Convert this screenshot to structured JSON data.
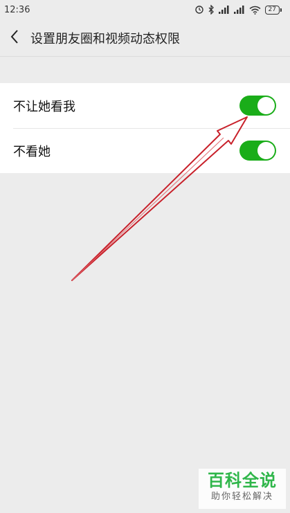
{
  "status_bar": {
    "time": "12:36",
    "battery": "27",
    "icons": [
      "alarm-icon",
      "bluetooth-icon",
      "signal-icon",
      "signal-icon",
      "wifi-icon",
      "battery-icon"
    ]
  },
  "header": {
    "back_icon": "chevron-left-icon",
    "title": "设置朋友圈和视频动态权限"
  },
  "settings": [
    {
      "label": "不让她看我",
      "enabled": true,
      "toggle_color": "#1aad19"
    },
    {
      "label": "不看她",
      "enabled": true,
      "toggle_color": "#1aad19"
    }
  ],
  "annotation": {
    "type": "arrow",
    "color": "#c8202a",
    "points_to": "settings.0.toggle"
  },
  "watermark": {
    "title": "百科全说",
    "subtitle": "助你轻松解决",
    "color": "#2fb64a"
  }
}
